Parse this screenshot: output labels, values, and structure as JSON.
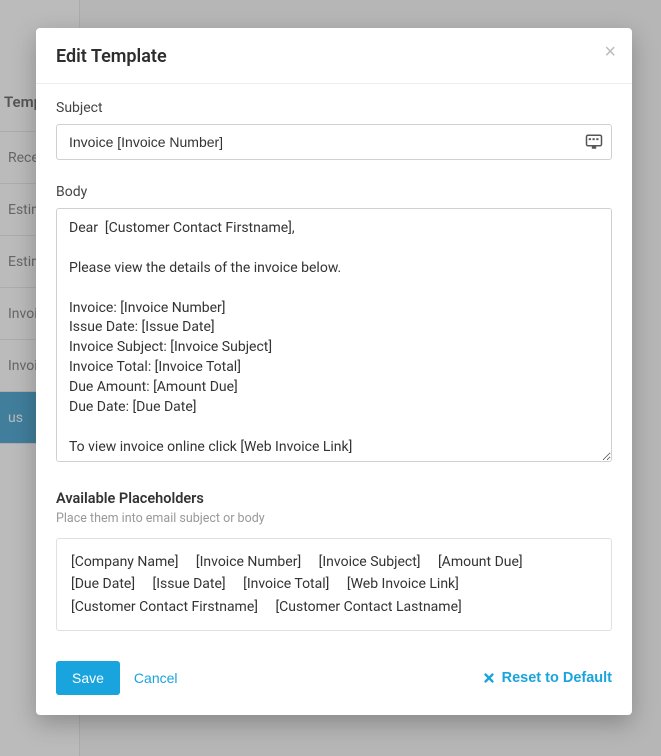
{
  "sidebar": {
    "heading": "Templates",
    "items": [
      {
        "label": "Receipt"
      },
      {
        "label": "Estimate"
      },
      {
        "label": "Estimate"
      },
      {
        "label": "Invoice"
      },
      {
        "label": "Invoice Re"
      },
      {
        "label": "us",
        "active": true
      }
    ]
  },
  "modal": {
    "title": "Edit Template",
    "subject_label": "Subject",
    "subject_value": "Invoice [Invoice Number]",
    "body_label": "Body",
    "body_value": "Dear  [Customer Contact Firstname],\n\nPlease view the details of the invoice below.\n\nInvoice: [Invoice Number]\nIssue Date: [Issue Date]\nInvoice Subject: [Invoice Subject]\nInvoice Total: [Invoice Total]\nDue Amount: [Amount Due]\nDue Date: [Due Date]\n\nTo view invoice online click [Web Invoice Link]",
    "placeholders_heading": "Available Placeholders",
    "placeholders_sub": "Place them into email subject or body",
    "placeholders": [
      "[Company Name]",
      "[Invoice Number]",
      "[Invoice Subject]",
      "[Amount Due]",
      "[Due Date]",
      "[Issue Date]",
      "[Invoice Total]",
      "[Web Invoice Link]",
      "[Customer Contact Firstname]",
      "[Customer Contact Lastname]"
    ],
    "save_label": "Save",
    "cancel_label": "Cancel",
    "reset_label": "Reset to Default"
  }
}
